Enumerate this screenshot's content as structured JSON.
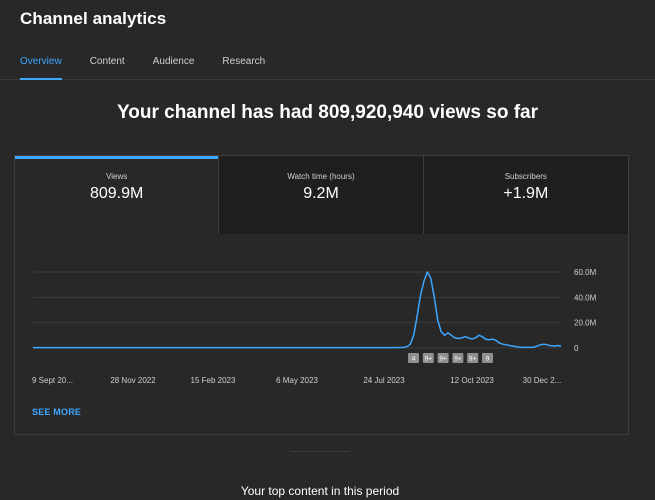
{
  "app": {
    "title": "Channel analytics"
  },
  "tabs": [
    {
      "label": "Overview",
      "active": true
    },
    {
      "label": "Content",
      "active": false
    },
    {
      "label": "Audience",
      "active": false
    },
    {
      "label": "Research",
      "active": false
    }
  ],
  "headline": "Your channel has had 809,920,940 views so far",
  "metrics": [
    {
      "label": "Views",
      "value": "809.9M",
      "active": true
    },
    {
      "label": "Watch time (hours)",
      "value": "9.2M",
      "active": false
    },
    {
      "label": "Subscribers",
      "value": "+1.9M",
      "active": false
    }
  ],
  "chart_data": {
    "type": "line",
    "series": [
      {
        "values": [
          0.3,
          0.3,
          0.3,
          0.3,
          0.3,
          0.3,
          0.3,
          0.3,
          0.3,
          0.3,
          0.3,
          0.3,
          0.3,
          0.3,
          0.3,
          0.3,
          0.3,
          0.3,
          0.3,
          0.3,
          0.3,
          0.3,
          0.3,
          0.3,
          0.3,
          0.3,
          0.3,
          0.4,
          0.5,
          1,
          3,
          10,
          25,
          42,
          53,
          60,
          55,
          40,
          22,
          13,
          10,
          12,
          10,
          8,
          7.5,
          8,
          9,
          8,
          7,
          8,
          10,
          9,
          7,
          6.5,
          7,
          6,
          4,
          3,
          2.5,
          2,
          1.5,
          1,
          0.7,
          0.5,
          0.5,
          0.5,
          0.7,
          1.5,
          2.5,
          3,
          2.5,
          1.8,
          1.5,
          2,
          1.5
        ]
      }
    ],
    "x_ticks": [
      "9 Sept 20...",
      "28 Nov 2022",
      "15 Feb 2023",
      "6 May 2023",
      "24 Jul 2023",
      "12 Oct 2023",
      "30 Dec 2..."
    ],
    "y_ticks": [
      "60.0M",
      "40.0M",
      "20.0M",
      "0"
    ],
    "ylim": [
      0,
      60
    ],
    "y_unit": "millions of views",
    "grid": true,
    "line_color": "#3ea6ff",
    "markers": [
      "4",
      "9+",
      "9+",
      "9+",
      "9+",
      "9"
    ]
  },
  "see_more": "SEE MORE",
  "next_section": {
    "title": "Your top content in this period"
  }
}
